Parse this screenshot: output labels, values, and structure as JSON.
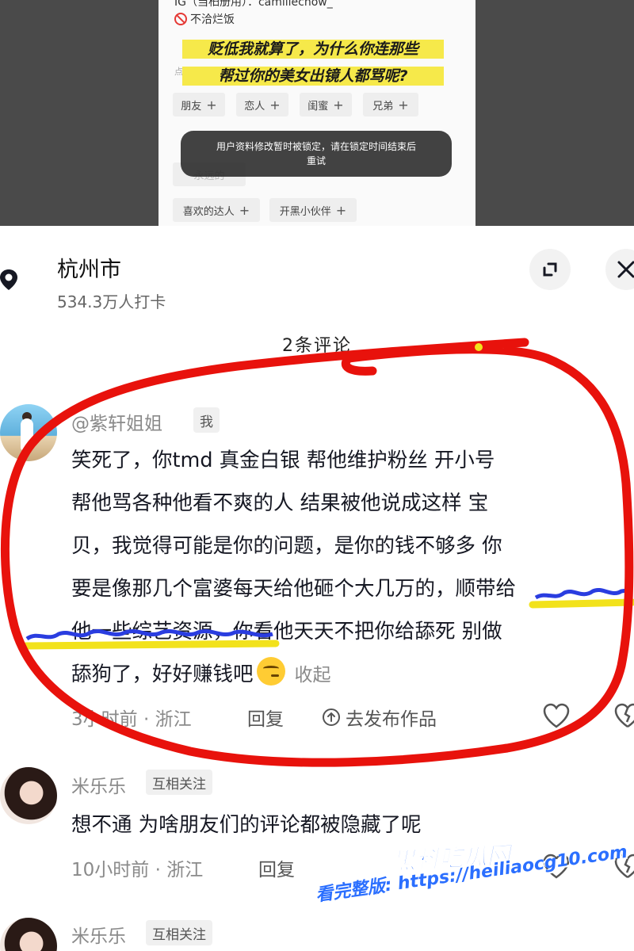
{
  "embedded_screenshot": {
    "ig_line": "IG（当桕册用）：camillechow_",
    "no_trap_text": "不洽烂饭",
    "caption_line1": "贬低我就算了，为什么你连那些",
    "caption_line2": "帮过你的美女出镜人都骂呢?",
    "click_hint": "点击",
    "chips": [
      {
        "label": "朋友",
        "plus": "+"
      },
      {
        "label": "恋人",
        "plus": "+"
      },
      {
        "label": "闺蜜",
        "plus": "+"
      },
      {
        "label": "兄弟",
        "plus": "+"
      },
      {
        "label": "喜欢的达人",
        "plus": "+"
      },
      {
        "label": "开黑小伙伴",
        "plus": "+"
      }
    ],
    "partial_chip_1": "永远的",
    "toast_line1": "用户资料修改暂时被锁定，请在锁定时间结束后",
    "toast_line2": "重试"
  },
  "location": {
    "title": "杭州市",
    "checkins": "534.3万人打卡"
  },
  "comment_count": "2条评论",
  "comments": [
    {
      "username": "@紫轩姐姐",
      "badge": "我",
      "lines": [
        "笑死了，你tmd 真金白银 帮他维护粉丝 开小号",
        "帮他骂各种他看不爽的人 结果被他说成这样    宝",
        "贝，我觉得可能是你的问题，是你的钱不够多 你",
        "要是像那几个富婆每天给他砸个大几万的，顺带给",
        "他一些综艺资源，你看他天天不把你给舔死  别做",
        "舔狗了，好好赚钱吧"
      ],
      "collapse": "收起",
      "meta": "3小时前 · 浙江",
      "reply": "回复",
      "publish": "去发布作品"
    },
    {
      "username": "米乐乐",
      "badge": "互相关注",
      "lines": [
        "想不通 为啥朋友们的评论都被隐藏了呢"
      ],
      "meta": "10小时前 · 浙江",
      "reply": "回复"
    },
    {
      "username": "米乐乐",
      "badge": "互相关注"
    }
  ],
  "watermark": {
    "title": "黑料吃瓜网",
    "url": "看完整版: https://heiliaocg10.com"
  },
  "colors": {
    "annotation_red": "#e8120c",
    "highlight_yellow": "#f2e21c",
    "scribble_blue": "#2a3de0",
    "watermark_blue": "#2b6fff"
  }
}
